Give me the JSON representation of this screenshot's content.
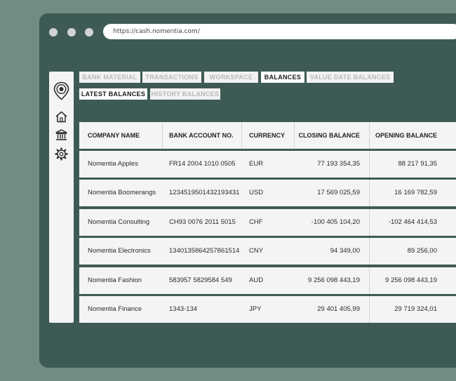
{
  "browser": {
    "url": "https://cash.nomentia.com/"
  },
  "sidebar": {
    "icons": [
      "location-pin-icon",
      "home-icon",
      "bank-icon",
      "gear-icon"
    ]
  },
  "tabs_row1": [
    {
      "label": "BANK MATERIAL",
      "active": false
    },
    {
      "label": "TRANSACTIONS",
      "active": false
    },
    {
      "label": "WORKSPACE",
      "active": false
    },
    {
      "label": "BALANCES",
      "active": true
    },
    {
      "label": "VALUE DATE BALANCES",
      "active": false
    }
  ],
  "tabs_row2": [
    {
      "label": "LATEST BALANCES",
      "active": true
    },
    {
      "label": "HISTORY BALANCES",
      "active": false
    }
  ],
  "table": {
    "headers": [
      "COMPANY NAME",
      "BANK ACCOUNT NO.",
      "CURRENCY",
      "CLOSING BALANCE",
      "OPENING BALANCE"
    ],
    "rows": [
      [
        "Nomentia Apples",
        "FR14 2004 1010 0505",
        "EUR",
        "77 193 354,35",
        "88 217 91,35"
      ],
      [
        "Nomentia Boomerangs",
        "1234519501432193431",
        "USD",
        "17 569 025,59",
        "16 169 782,59"
      ],
      [
        "Nomentia Consulting",
        "CH93 0076 2011 5015",
        "CHF",
        "-100 405 104,20",
        "-102 464 414,53"
      ],
      [
        "Nomentia Electronics",
        "1340135864257861514",
        "CNY",
        "94 349,00",
        "89 256,00"
      ],
      [
        "Nomentia Fashion",
        "583957 5829584 549",
        "AUD",
        "9 256 098 443,19",
        "9 256 098 443,19"
      ],
      [
        "Nomentia Finance",
        "1343-134",
        "JPY",
        "29 401 405,99",
        "29 719 324,01"
      ]
    ]
  }
}
